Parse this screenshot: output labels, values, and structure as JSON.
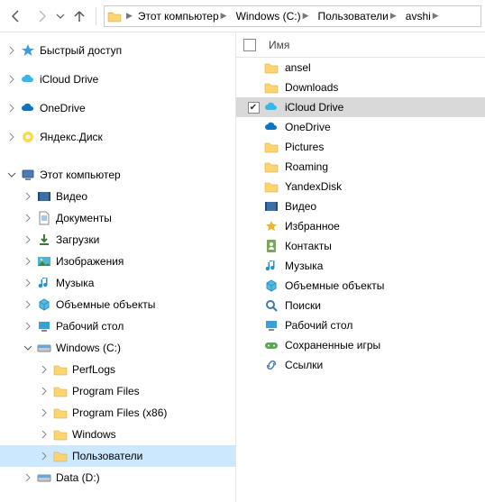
{
  "breadcrumb": [
    "Этот компьютер",
    "Windows (C:)",
    "Пользователи",
    "avshi"
  ],
  "list_header": {
    "name_col": "Имя"
  },
  "tree": {
    "quick": [
      {
        "id": "quick-access",
        "label": "Быстрый доступ",
        "icon": "star",
        "expandable": true,
        "expanded": false
      },
      {
        "id": "icloud-drive",
        "label": "iCloud Drive",
        "icon": "icloud",
        "expandable": true,
        "expanded": false
      },
      {
        "id": "onedrive",
        "label": "OneDrive",
        "icon": "onedrive",
        "expandable": true,
        "expanded": false
      },
      {
        "id": "yandex-disk",
        "label": "Яндекс.Диск",
        "icon": "yandex",
        "expandable": true,
        "expanded": false
      }
    ],
    "pc_label": "Этот компьютер",
    "pc_children": [
      {
        "id": "video",
        "label": "Видео",
        "icon": "video"
      },
      {
        "id": "documents",
        "label": "Документы",
        "icon": "documents"
      },
      {
        "id": "downloads",
        "label": "Загрузки",
        "icon": "downloads"
      },
      {
        "id": "pictures",
        "label": "Изображения",
        "icon": "pictures"
      },
      {
        "id": "music",
        "label": "Музыка",
        "icon": "music"
      },
      {
        "id": "3d",
        "label": "Объемные объекты",
        "icon": "objects3d"
      },
      {
        "id": "desktop",
        "label": "Рабочий стол",
        "icon": "desktop"
      }
    ],
    "c_drive": {
      "label": "Windows (C:)",
      "children": [
        {
          "id": "perflogs",
          "label": "PerfLogs"
        },
        {
          "id": "program-files",
          "label": "Program Files"
        },
        {
          "id": "program-files-x86",
          "label": "Program Files (x86)"
        },
        {
          "id": "windows-folder",
          "label": "Windows"
        },
        {
          "id": "users",
          "label": "Пользователи",
          "selected": true
        }
      ]
    },
    "d_drive": {
      "label": "Data (D:)"
    }
  },
  "items": [
    {
      "id": "ansel",
      "label": "ansel",
      "icon": "folder"
    },
    {
      "id": "downloads",
      "label": "Downloads",
      "icon": "folder"
    },
    {
      "id": "icloud-drive",
      "label": "iCloud Drive",
      "icon": "icloud",
      "selected": true
    },
    {
      "id": "onedrive",
      "label": "OneDrive",
      "icon": "onedrive"
    },
    {
      "id": "pictures",
      "label": "Pictures",
      "icon": "folder"
    },
    {
      "id": "roaming",
      "label": "Roaming",
      "icon": "folder"
    },
    {
      "id": "yandexdisk",
      "label": "YandexDisk",
      "icon": "folder"
    },
    {
      "id": "video",
      "label": "Видео",
      "icon": "video"
    },
    {
      "id": "favorites",
      "label": "Избранное",
      "icon": "star-folder"
    },
    {
      "id": "contacts",
      "label": "Контакты",
      "icon": "contacts"
    },
    {
      "id": "music",
      "label": "Музыка",
      "icon": "music"
    },
    {
      "id": "3d",
      "label": "Объемные объекты",
      "icon": "objects3d"
    },
    {
      "id": "search",
      "label": "Поиски",
      "icon": "search-folder"
    },
    {
      "id": "desktop",
      "label": "Рабочий стол",
      "icon": "desktop"
    },
    {
      "id": "saved-games",
      "label": "Сохраненные игры",
      "icon": "games"
    },
    {
      "id": "links",
      "label": "Ссылки",
      "icon": "links"
    }
  ]
}
